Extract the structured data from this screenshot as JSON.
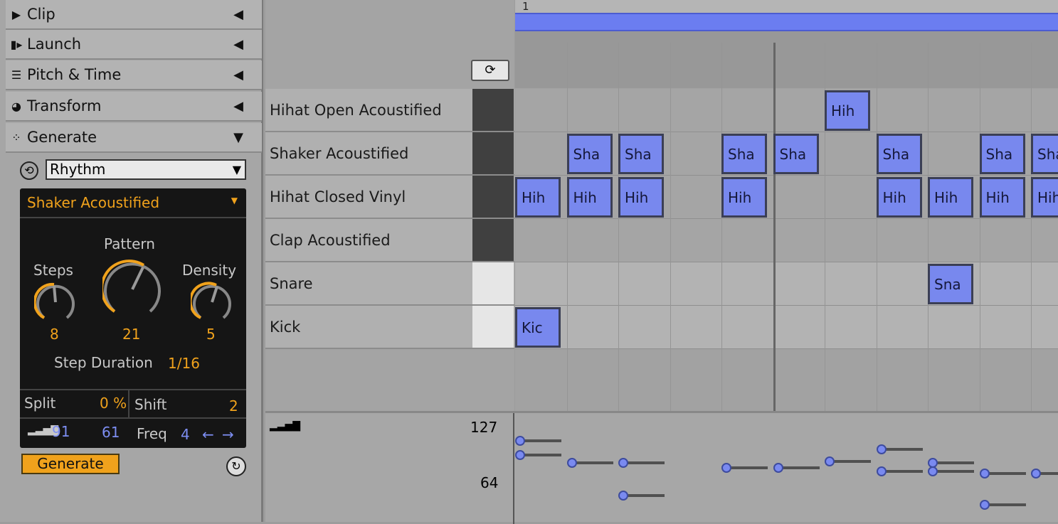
{
  "device_sections": [
    {
      "label": "Clip",
      "icon": "clip-icon",
      "state": "collapsed"
    },
    {
      "label": "Launch",
      "icon": "launch-icon",
      "state": "collapsed"
    },
    {
      "label": "Pitch & Time",
      "icon": "pitch-time-icon",
      "state": "collapsed"
    },
    {
      "label": "Transform",
      "icon": "transform-icon",
      "state": "collapsed"
    },
    {
      "label": "Generate",
      "icon": "generate-icon",
      "state": "expanded"
    }
  ],
  "generator": {
    "selected": "Rhythm"
  },
  "rhythm": {
    "target": "Shaker Acoustified",
    "pattern_label": "Pattern",
    "pattern_value": "21",
    "steps_label": "Steps",
    "steps_value": "8",
    "density_label": "Density",
    "density_value": "5",
    "step_duration_label": "Step Duration",
    "step_duration_value": "1/16",
    "split_label": "Split",
    "split_value": "0 %",
    "shift_label": "Shift",
    "shift_value": "2",
    "velocity_value": "91",
    "velocity_range": "61",
    "freq_label": "Freq",
    "freq_value": "4",
    "generate_label": "Generate"
  },
  "ruler": {
    "bar1": "1"
  },
  "tracks": [
    {
      "name": "Hihat Open Acoustified",
      "swatch": "#404040"
    },
    {
      "name": "Shaker Acoustified",
      "swatch": "#404040"
    },
    {
      "name": "Hihat Closed Vinyl",
      "swatch": "#404040"
    },
    {
      "name": "Clap Acoustified",
      "swatch": "#404040"
    },
    {
      "name": "Snare",
      "swatch": "#e6e6e6"
    },
    {
      "name": "Kick",
      "swatch": "#e6e6e6"
    }
  ],
  "notes": [
    {
      "row": 0,
      "step": 6,
      "label": "Hih"
    },
    {
      "row": 1,
      "step": 1,
      "label": "Sha"
    },
    {
      "row": 1,
      "step": 2,
      "label": "Sha"
    },
    {
      "row": 1,
      "step": 4,
      "label": "Sha"
    },
    {
      "row": 1,
      "step": 5,
      "label": "Sha"
    },
    {
      "row": 1,
      "step": 7,
      "label": "Sha"
    },
    {
      "row": 1,
      "step": 9,
      "label": "Sha"
    },
    {
      "row": 1,
      "step": 10,
      "label": "Sha"
    },
    {
      "row": 2,
      "step": 0,
      "label": "Hih"
    },
    {
      "row": 2,
      "step": 1,
      "label": "Hih"
    },
    {
      "row": 2,
      "step": 2,
      "label": "Hih"
    },
    {
      "row": 2,
      "step": 4,
      "label": "Hih"
    },
    {
      "row": 2,
      "step": 7,
      "label": "Hih"
    },
    {
      "row": 2,
      "step": 8,
      "label": "Hih"
    },
    {
      "row": 2,
      "step": 9,
      "label": "Hih"
    },
    {
      "row": 2,
      "step": 10,
      "label": "Hih"
    },
    {
      "row": 4,
      "step": 8,
      "label": "Sna"
    },
    {
      "row": 5,
      "step": 0,
      "label": "Kic"
    }
  ],
  "velocity_lane": {
    "ticks": [
      "127",
      "64"
    ],
    "points": [
      {
        "step": 0,
        "vel": 117
      },
      {
        "step": 0,
        "vel": 101
      },
      {
        "step": 1,
        "vel": 92
      },
      {
        "step": 2,
        "vel": 92
      },
      {
        "step": 2,
        "vel": 55
      },
      {
        "step": 4,
        "vel": 87
      },
      {
        "step": 5,
        "vel": 87
      },
      {
        "step": 6,
        "vel": 94
      },
      {
        "step": 7,
        "vel": 108
      },
      {
        "step": 7,
        "vel": 83
      },
      {
        "step": 8,
        "vel": 92
      },
      {
        "step": 8,
        "vel": 83
      },
      {
        "step": 9,
        "vel": 80
      },
      {
        "step": 9,
        "vel": 45
      },
      {
        "step": 10,
        "vel": 80
      }
    ]
  },
  "colors": {
    "accent": "#f0a21c",
    "note": "#7888ee",
    "loop_bar": "#6b7df0"
  }
}
